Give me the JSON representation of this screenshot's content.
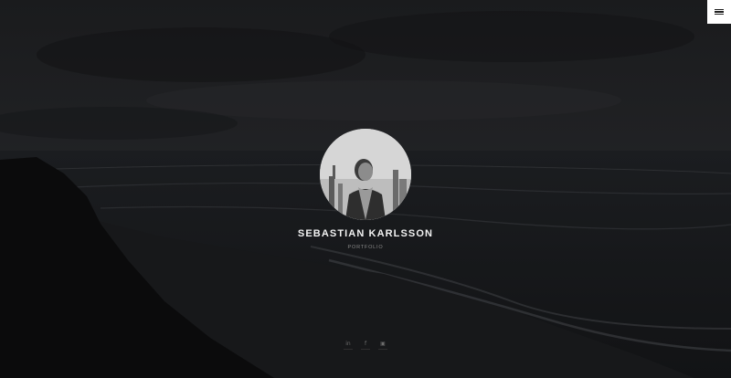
{
  "profile": {
    "name": "SEBASTIAN KARLSSON",
    "subtitle": "PORTFOLIO"
  },
  "social": {
    "linkedin_icon_text": "in",
    "facebook_icon_text": "f",
    "instagram_icon_text": "▣"
  },
  "header": {
    "menu_icon": "hamburger-menu-icon"
  },
  "colors": {
    "background": "#0f1012",
    "menu_bg": "#ffffff",
    "name_text": "#f2f2f2",
    "subtitle_text": "#8a8a8a"
  }
}
